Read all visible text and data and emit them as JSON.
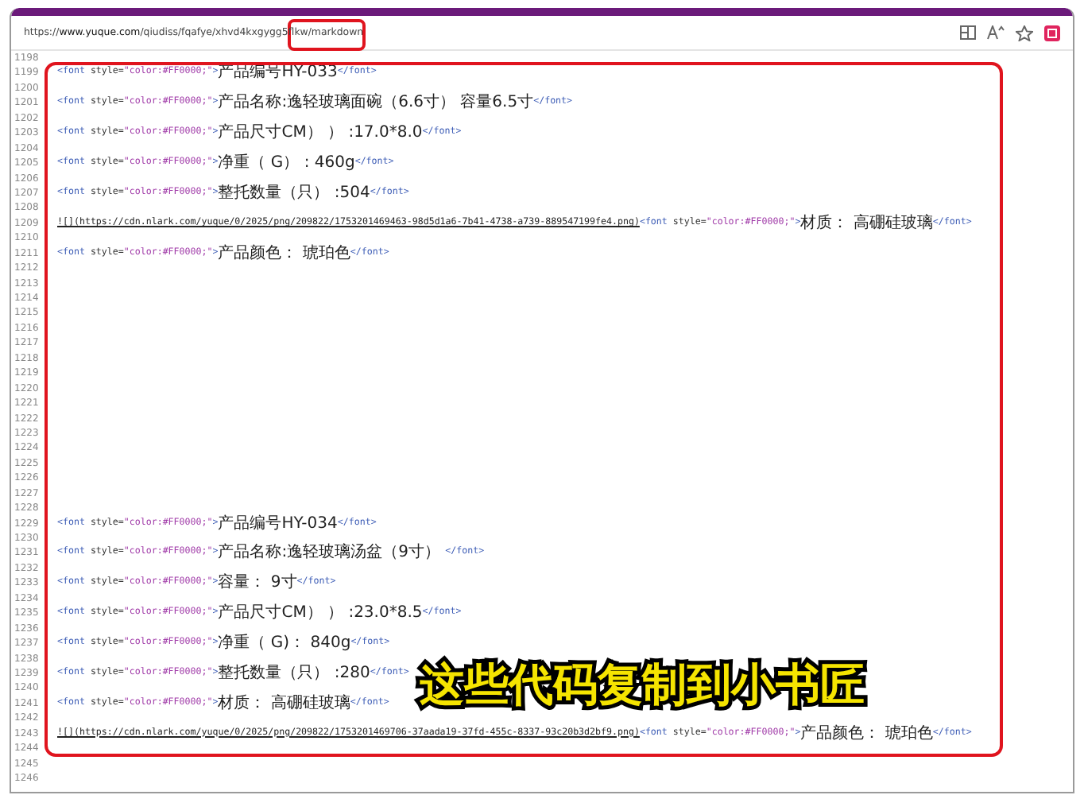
{
  "browser": {
    "url": {
      "scheme": "https://",
      "domain": "www.yuque.com",
      "path": "/qiudiss/fqafye/xhvd4kxgygg5flkw/markdown"
    }
  },
  "editor": {
    "lines": [
      {
        "number": "1198"
      },
      {
        "number": "1199",
        "segments": [
          {
            "kind": "tag",
            "text": "<font"
          },
          {
            "kind": "attr",
            "text": " style="
          },
          {
            "kind": "string",
            "text": "\"color:#FF0000;\""
          },
          {
            "kind": "tag",
            "text": ">"
          },
          {
            "kind": "text",
            "text": "产品编号HY-033"
          },
          {
            "kind": "tag",
            "text": "</font>"
          }
        ]
      },
      {
        "number": "1200"
      },
      {
        "number": "1201",
        "segments": [
          {
            "kind": "tag",
            "text": "<font"
          },
          {
            "kind": "attr",
            "text": " style="
          },
          {
            "kind": "string",
            "text": "\"color:#FF0000;\""
          },
          {
            "kind": "tag",
            "text": ">"
          },
          {
            "kind": "text",
            "text": "产品名称:逸轻玻璃面碗（6.6寸） 容量6.5寸"
          },
          {
            "kind": "tag",
            "text": "</font>"
          }
        ]
      },
      {
        "number": "1202"
      },
      {
        "number": "1203",
        "segments": [
          {
            "kind": "tag",
            "text": "<font"
          },
          {
            "kind": "attr",
            "text": " style="
          },
          {
            "kind": "string",
            "text": "\"color:#FF0000;\""
          },
          {
            "kind": "tag",
            "text": ">"
          },
          {
            "kind": "text",
            "text": "产品尺寸CM） ） :17.0*8.0"
          },
          {
            "kind": "tag",
            "text": "</font>"
          }
        ]
      },
      {
        "number": "1204"
      },
      {
        "number": "1205",
        "segments": [
          {
            "kind": "tag",
            "text": "<font"
          },
          {
            "kind": "attr",
            "text": " style="
          },
          {
            "kind": "string",
            "text": "\"color:#FF0000;\""
          },
          {
            "kind": "tag",
            "text": ">"
          },
          {
            "kind": "text",
            "text": "净重（ G） : 460g"
          },
          {
            "kind": "tag",
            "text": "</font>"
          }
        ]
      },
      {
        "number": "1206"
      },
      {
        "number": "1207",
        "segments": [
          {
            "kind": "tag",
            "text": "<font"
          },
          {
            "kind": "attr",
            "text": " style="
          },
          {
            "kind": "string",
            "text": "\"color:#FF0000;\""
          },
          {
            "kind": "tag",
            "text": ">"
          },
          {
            "kind": "text",
            "text": "整托数量（只） :504"
          },
          {
            "kind": "tag",
            "text": "</font>"
          }
        ]
      },
      {
        "number": "1208"
      },
      {
        "number": "1209",
        "segments": [
          {
            "kind": "link",
            "text": "![](https://cdn.nlark.com/yuque/0/2025/png/209822/1753201469463-98d5d1a6-7b41-4738-a739-889547199fe4.png)"
          },
          {
            "kind": "tag",
            "text": "<font"
          },
          {
            "kind": "attr",
            "text": " style="
          },
          {
            "kind": "string",
            "text": "\"color:#FF0000;\""
          },
          {
            "kind": "tag",
            "text": ">"
          },
          {
            "kind": "text",
            "text": "材质： 高硼硅玻璃"
          },
          {
            "kind": "tag",
            "text": "</font>"
          }
        ]
      },
      {
        "number": "1210"
      },
      {
        "number": "1211",
        "segments": [
          {
            "kind": "tag",
            "text": "<font"
          },
          {
            "kind": "attr",
            "text": " style="
          },
          {
            "kind": "string",
            "text": "\"color:#FF0000;\""
          },
          {
            "kind": "tag",
            "text": ">"
          },
          {
            "kind": "text",
            "text": "产品颜色： 琥珀色"
          },
          {
            "kind": "tag",
            "text": "</font>"
          }
        ]
      },
      {
        "number": "1212"
      },
      {
        "number": "1213"
      },
      {
        "number": "1214"
      },
      {
        "number": "1215"
      },
      {
        "number": "1216"
      },
      {
        "number": "1217"
      },
      {
        "number": "1218"
      },
      {
        "number": "1219"
      },
      {
        "number": "1220"
      },
      {
        "number": "1221"
      },
      {
        "number": "1222"
      },
      {
        "number": "1223"
      },
      {
        "number": "1224"
      },
      {
        "number": "1225"
      },
      {
        "number": "1226"
      },
      {
        "number": "1227"
      },
      {
        "number": "1228"
      },
      {
        "number": "1229",
        "segments": [
          {
            "kind": "tag",
            "text": "<font"
          },
          {
            "kind": "attr",
            "text": " style="
          },
          {
            "kind": "string",
            "text": "\"color:#FF0000;\""
          },
          {
            "kind": "tag",
            "text": ">"
          },
          {
            "kind": "text",
            "text": "产品编号HY-034"
          },
          {
            "kind": "tag",
            "text": "</font>"
          }
        ]
      },
      {
        "number": "1230"
      },
      {
        "number": "1231",
        "segments": [
          {
            "kind": "tag",
            "text": "<font"
          },
          {
            "kind": "attr",
            "text": " style="
          },
          {
            "kind": "string",
            "text": "\"color:#FF0000;\""
          },
          {
            "kind": "tag",
            "text": ">"
          },
          {
            "kind": "text",
            "text": "产品名称:逸轻玻璃汤盆（9寸） "
          },
          {
            "kind": "tag",
            "text": "</font>"
          }
        ]
      },
      {
        "number": "1232"
      },
      {
        "number": "1233",
        "segments": [
          {
            "kind": "tag",
            "text": "<font"
          },
          {
            "kind": "attr",
            "text": " style="
          },
          {
            "kind": "string",
            "text": "\"color:#FF0000;\""
          },
          {
            "kind": "tag",
            "text": ">"
          },
          {
            "kind": "text",
            "text": "容量： 9寸"
          },
          {
            "kind": "tag",
            "text": "</font>"
          }
        ]
      },
      {
        "number": "1234"
      },
      {
        "number": "1235",
        "segments": [
          {
            "kind": "tag",
            "text": "<font"
          },
          {
            "kind": "attr",
            "text": " style="
          },
          {
            "kind": "string",
            "text": "\"color:#FF0000;\""
          },
          {
            "kind": "tag",
            "text": ">"
          },
          {
            "kind": "text",
            "text": "产品尺寸CM） ） :23.0*8.5"
          },
          {
            "kind": "tag",
            "text": "</font>"
          }
        ]
      },
      {
        "number": "1236"
      },
      {
        "number": "1237",
        "segments": [
          {
            "kind": "tag",
            "text": "<font"
          },
          {
            "kind": "attr",
            "text": " style="
          },
          {
            "kind": "string",
            "text": "\"color:#FF0000;\""
          },
          {
            "kind": "tag",
            "text": ">"
          },
          {
            "kind": "text",
            "text": "净重（ G)： 840g"
          },
          {
            "kind": "tag",
            "text": "</font>"
          }
        ]
      },
      {
        "number": "1238"
      },
      {
        "number": "1239",
        "segments": [
          {
            "kind": "tag",
            "text": "<font"
          },
          {
            "kind": "attr",
            "text": " style="
          },
          {
            "kind": "string",
            "text": "\"color:#FF0000;\""
          },
          {
            "kind": "tag",
            "text": ">"
          },
          {
            "kind": "text",
            "text": "整托数量（只） :280"
          },
          {
            "kind": "tag",
            "text": "</font>"
          }
        ]
      },
      {
        "number": "1240"
      },
      {
        "number": "1241",
        "segments": [
          {
            "kind": "tag",
            "text": "<font"
          },
          {
            "kind": "attr",
            "text": " style="
          },
          {
            "kind": "string",
            "text": "\"color:#FF0000;\""
          },
          {
            "kind": "tag",
            "text": ">"
          },
          {
            "kind": "text",
            "text": "材质： 高硼硅玻璃"
          },
          {
            "kind": "tag",
            "text": "</font>"
          }
        ]
      },
      {
        "number": "1242"
      },
      {
        "number": "1243",
        "segments": [
          {
            "kind": "link",
            "text": "![](https://cdn.nlark.com/yuque/0/2025/png/209822/1753201469706-37aada19-37fd-455c-8337-93c20b3d2bf9.png)"
          },
          {
            "kind": "tag",
            "text": "<font"
          },
          {
            "kind": "attr",
            "text": " style="
          },
          {
            "kind": "string",
            "text": "\"color:#FF0000;\""
          },
          {
            "kind": "tag",
            "text": ">"
          },
          {
            "kind": "text",
            "text": "产品颜色： 琥珀色"
          },
          {
            "kind": "tag",
            "text": "</font>"
          }
        ]
      },
      {
        "number": "1244"
      },
      {
        "number": "1245"
      },
      {
        "number": "1246"
      }
    ]
  },
  "annotation": {
    "caption": "这些代码复制到小书匠"
  }
}
